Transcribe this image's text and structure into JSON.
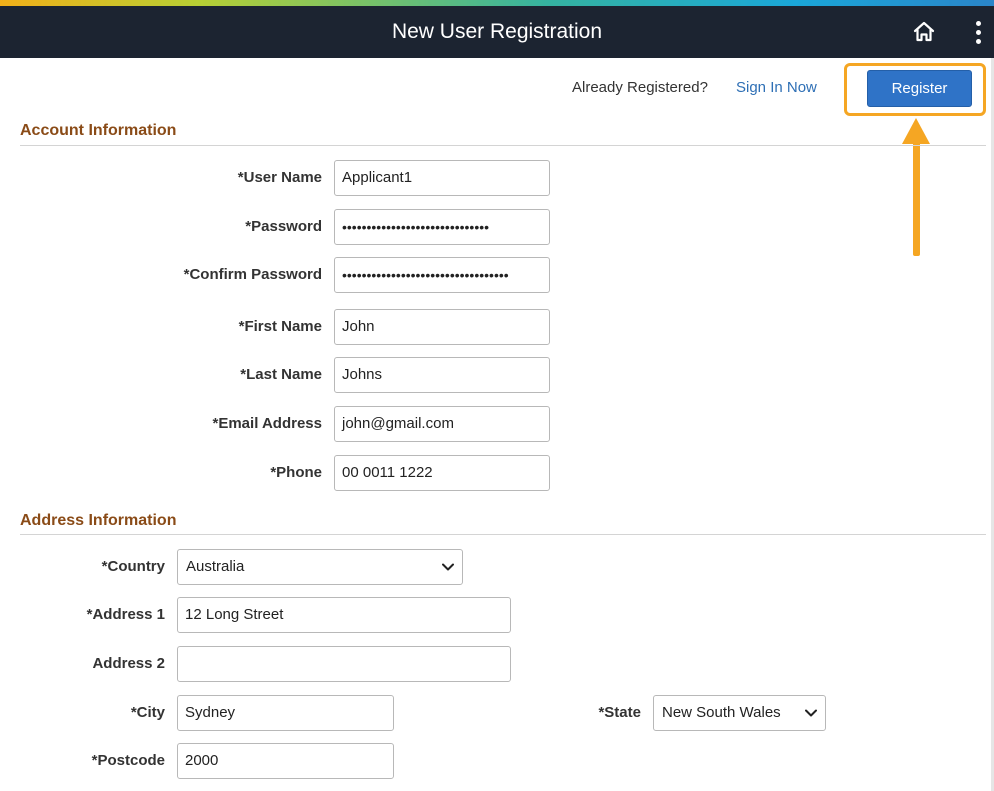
{
  "header": {
    "title": "New User Registration",
    "home_icon": "home-icon",
    "menu_icon": "more-vertical-icon"
  },
  "top": {
    "already_text": "Already Registered?",
    "signin_link": "Sign In Now",
    "register_label": "Register"
  },
  "account": {
    "section_title": "Account Information",
    "user_name": {
      "label": "*User Name",
      "value": "Applicant1"
    },
    "password": {
      "label": "*Password",
      "value": "••••••••••••••••••••••••••••••"
    },
    "confirm_password": {
      "label": "*Confirm Password",
      "value": "••••••••••••••••••••••••••••••••••"
    },
    "first_name": {
      "label": "*First Name",
      "value": "John"
    },
    "last_name": {
      "label": "*Last Name",
      "value": "Johns"
    },
    "email": {
      "label": "*Email Address",
      "value": "john@gmail.com"
    },
    "phone": {
      "label": "*Phone",
      "value": "00 0011 1222"
    }
  },
  "address": {
    "section_title": "Address Information",
    "country": {
      "label": "*Country",
      "value": "Australia"
    },
    "address1": {
      "label": "*Address 1",
      "value": "12 Long Street"
    },
    "address2": {
      "label": "Address 2",
      "value": ""
    },
    "city": {
      "label": "*City",
      "value": "Sydney"
    },
    "state": {
      "label": "*State",
      "value": "New South Wales"
    },
    "postcode": {
      "label": "*Postcode",
      "value": "2000"
    }
  },
  "colors": {
    "header_bg": "#1c2431",
    "section_title": "#8a4b17",
    "primary_button": "#2f73c7",
    "link": "#2e6fb5",
    "highlight": "#f5a623"
  }
}
